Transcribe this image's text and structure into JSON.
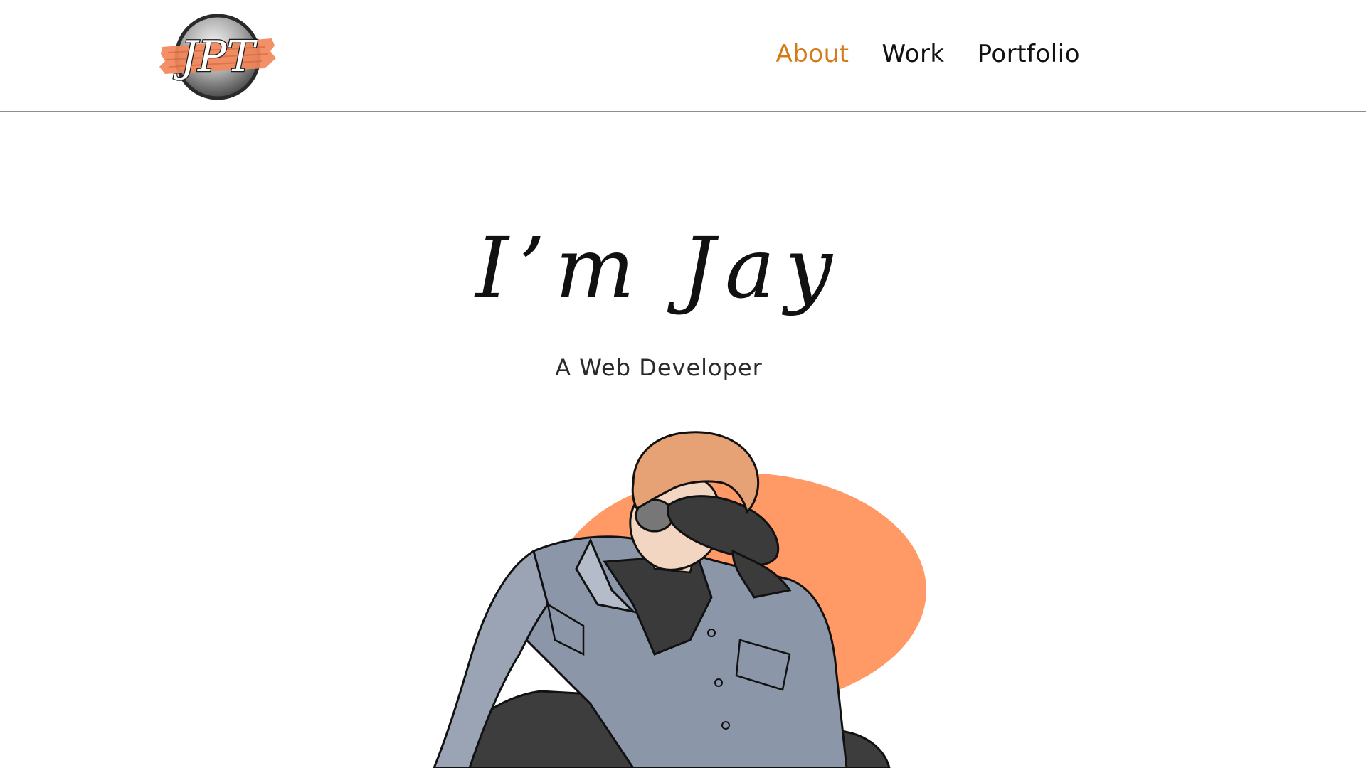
{
  "header": {
    "logo_text": "JPT",
    "nav": [
      {
        "label": "About",
        "active": true
      },
      {
        "label": "Work",
        "active": false
      },
      {
        "label": "Portfolio",
        "active": false
      }
    ]
  },
  "hero": {
    "title": "I’m Jay",
    "subtitle": "A Web Developer"
  },
  "colors": {
    "accent": "#d37b18",
    "blob": "#ff9966",
    "text": "#111111",
    "divider": "#8d8d8d"
  }
}
